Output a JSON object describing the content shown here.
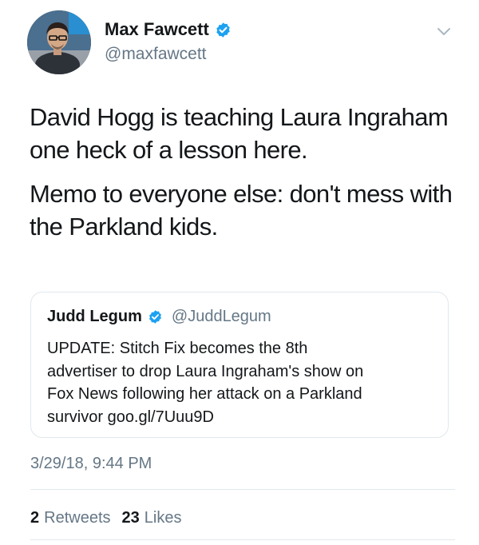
{
  "author": {
    "name": "Max Fawcett",
    "handle": "@maxfawcett",
    "verified": true,
    "avatar_icon": "profile-photo"
  },
  "tweet": {
    "paragraphs": [
      "David Hogg is teaching Laura Ingraham one heck of a lesson here.",
      "Memo to everyone else: don't mess with the Parkland kids."
    ],
    "timestamp": "3/29/18, 9:44 PM"
  },
  "quoted_tweet": {
    "name": "Judd Legum",
    "handle": "@JuddLegum",
    "verified": true,
    "text": "UPDATE: Stitch Fix becomes the 8th\nadvertiser to drop Laura Ingraham's show on\nFox News following her attack on a Parkland\nsurvivor goo.gl/7Uuu9D"
  },
  "stats": {
    "retweets_count": "2",
    "retweets_label": "Retweets",
    "likes_count": "23",
    "likes_label": "Likes"
  },
  "colors": {
    "verified_blue": "#1da1f2",
    "secondary_text": "#657786",
    "primary_text": "#14171a",
    "border": "#e1e8ed"
  }
}
